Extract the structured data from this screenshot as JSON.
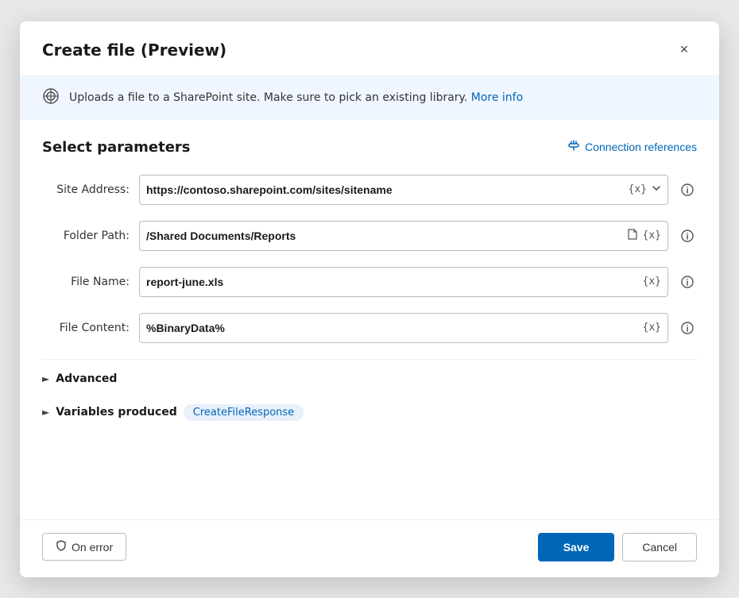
{
  "dialog": {
    "title": "Create file (Preview)",
    "close_label": "×"
  },
  "info_banner": {
    "text": "Uploads a file to a SharePoint site. Make sure to pick an existing library.",
    "link_text": "More info"
  },
  "section": {
    "title": "Select parameters",
    "connection_ref_label": "Connection references"
  },
  "fields": [
    {
      "label": "Site Address:",
      "value": "https://contoso.sharepoint.com/sites/sitename",
      "badge": "{x}",
      "has_chevron": true,
      "has_file_icon": false,
      "info": true
    },
    {
      "label": "Folder Path:",
      "value": "/Shared Documents/Reports",
      "badge": "{x}",
      "has_chevron": false,
      "has_file_icon": true,
      "info": true
    },
    {
      "label": "File Name:",
      "value": "report-june.xls",
      "badge": "{x}",
      "has_chevron": false,
      "has_file_icon": false,
      "info": true
    },
    {
      "label": "File Content:",
      "value": "%BinaryData%",
      "badge": "{x}",
      "has_chevron": false,
      "has_file_icon": false,
      "info": true
    }
  ],
  "advanced": {
    "label": "Advanced"
  },
  "variables": {
    "label": "Variables produced",
    "tag": "CreateFileResponse"
  },
  "footer": {
    "on_error_label": "On error",
    "save_label": "Save",
    "cancel_label": "Cancel"
  }
}
